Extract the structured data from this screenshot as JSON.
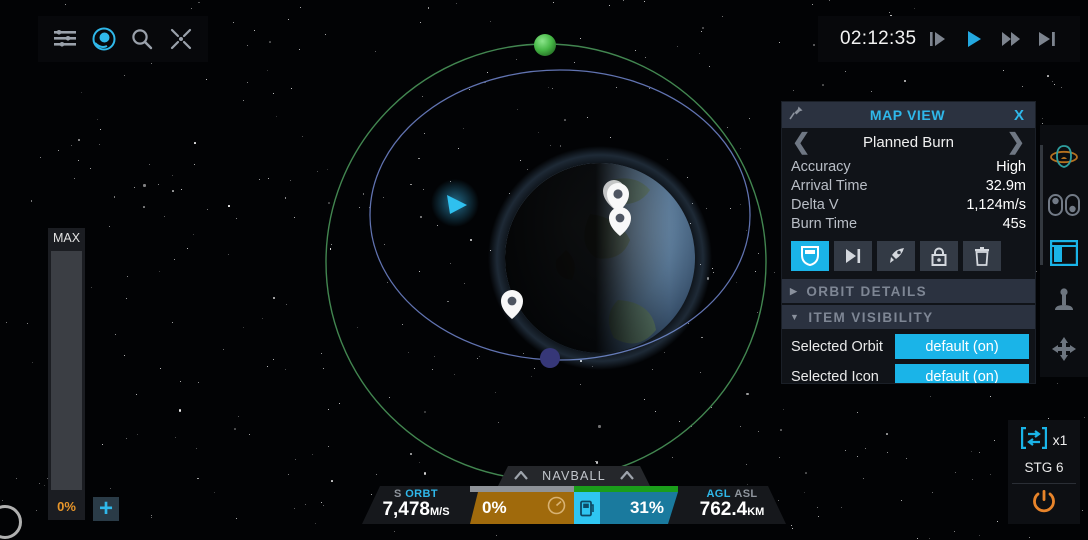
{
  "toolbar": {
    "icons": [
      {
        "name": "menu-icon",
        "label": "Menu"
      },
      {
        "name": "map-view-icon",
        "label": "Map View"
      },
      {
        "name": "search-icon",
        "label": "Search"
      },
      {
        "name": "focus-icon",
        "label": "Focus"
      }
    ]
  },
  "time_controls": {
    "clock": "02:12:35",
    "buttons": [
      {
        "name": "step-frame-button",
        "label": "Step",
        "active": false
      },
      {
        "name": "play-button",
        "label": "Play",
        "active": true
      },
      {
        "name": "fast-forward-button",
        "label": "Fast Forward",
        "active": false
      },
      {
        "name": "skip-to-end-button",
        "label": "Skip",
        "active": false
      }
    ]
  },
  "right_sidebar": {
    "items": [
      {
        "name": "orbit-view-icon",
        "label": "Orbit View",
        "active": false
      },
      {
        "name": "toggles-icon",
        "label": "Toggles",
        "active": false
      },
      {
        "name": "panel-layout-icon",
        "label": "Panel Layout",
        "active": true
      },
      {
        "name": "joystick-icon",
        "label": "Controls",
        "active": false
      },
      {
        "name": "pan-move-icon",
        "label": "Pan",
        "active": false
      }
    ]
  },
  "map_view": {
    "title": "MAP VIEW",
    "close_label": "X",
    "pin_icon": "pin-icon",
    "nav": {
      "prev_label": "❮",
      "next_label": "❯",
      "current": "Planned Burn"
    },
    "rows": [
      {
        "key": "Accuracy",
        "value": "High"
      },
      {
        "key": "Arrival Time",
        "value": "32.9m"
      },
      {
        "key": "Delta V",
        "value": "1,124m/s"
      },
      {
        "key": "Burn Time",
        "value": "45s"
      }
    ],
    "actions": [
      {
        "name": "maneuver-node-button",
        "label": "Maneuver Node",
        "active": true
      },
      {
        "name": "next-node-button",
        "label": "Next Node",
        "active": false
      },
      {
        "name": "warp-to-burn-button",
        "label": "Warp To Burn",
        "active": false
      },
      {
        "name": "lock-node-button",
        "label": "Lock Node",
        "active": false
      },
      {
        "name": "delete-node-button",
        "label": "Delete Node",
        "active": false
      }
    ],
    "sections": [
      {
        "name": "orbit-details-section",
        "label": "ORBIT DETAILS",
        "expanded": false,
        "marker": "▶"
      },
      {
        "name": "item-visibility-section",
        "label": "ITEM VISIBILITY",
        "expanded": true,
        "marker": "▼"
      }
    ],
    "visibility": [
      {
        "label": "Selected Orbit",
        "value": "default (on)"
      },
      {
        "label": "Selected Icon",
        "value": "default (on)"
      }
    ]
  },
  "throttle": {
    "max_label": "MAX",
    "value_label": "0%",
    "percent": 0,
    "add_label": "+"
  },
  "navball": {
    "tab_label": "NAVBALL",
    "speed": {
      "prefix": "S",
      "mode": "ORBT",
      "value": "7,478",
      "unit": "M/S"
    },
    "altitude": {
      "mode": "AGL",
      "alt_mode": "ASL",
      "value": "762.4",
      "unit": "KM"
    },
    "throttle_pct": "0%",
    "fuel_pct": "31%",
    "throttle_bar": 0,
    "fuel_bar": 100
  },
  "staging": {
    "stage_multiplier": "x1",
    "stage_label": "STG 6",
    "power_icon": "power-icon"
  },
  "colors": {
    "accent_cyan": "#2fb8ea",
    "bright_cyan": "#1ab4e8",
    "orange": "#e8962a",
    "green": "#1b9e1b",
    "panel_bg": "#101318",
    "header_bg": "#2b3240"
  },
  "map_scene": {
    "planet_name": "home-planet",
    "orbits": [
      {
        "name": "vessel-orbit",
        "color": "#5b6fb8"
      },
      {
        "name": "target-orbit",
        "color": "#4e9e5e"
      }
    ],
    "markers": [
      {
        "name": "map-marker-stacked"
      },
      {
        "name": "map-marker-single"
      },
      {
        "name": "map-marker-left"
      }
    ],
    "vessel_icon": "vessel-prograde-icon",
    "nodes": [
      {
        "name": "maneuver-node-purple",
        "color": "#3a3a8c"
      },
      {
        "name": "target-node-green",
        "color": "#4fc44f"
      }
    ]
  }
}
